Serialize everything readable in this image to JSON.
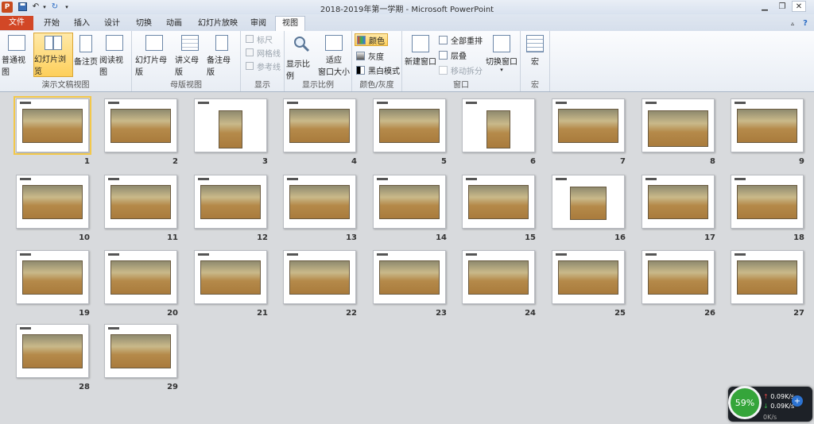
{
  "window": {
    "title": "2018-2019年第一学期 - Microsoft PowerPoint",
    "app_icon": "P"
  },
  "tabs": [
    "文件",
    "开始",
    "插入",
    "设计",
    "切换",
    "动画",
    "幻灯片放映",
    "审阅",
    "视图"
  ],
  "ribbon": {
    "presentation_views": {
      "label": "演示文稿视图",
      "buttons": [
        "普通视图",
        "幻灯片浏览",
        "备注页",
        "阅读视图"
      ]
    },
    "master_views": {
      "label": "母版视图",
      "buttons": [
        "幻灯片母版",
        "讲义母版",
        "备注母版"
      ]
    },
    "show": {
      "label": "显示",
      "checks": [
        "标尺",
        "网格线",
        "参考线"
      ]
    },
    "zoom": {
      "label": "显示比例",
      "buttons": [
        "显示比例",
        "适应",
        "窗口大小"
      ]
    },
    "color": {
      "label": "颜色/灰度",
      "buttons": [
        "颜色",
        "灰度",
        "黑白模式"
      ]
    },
    "window": {
      "label": "窗口",
      "new_window": "新建窗口",
      "arrange_all": "全部重排",
      "cascade": "层叠",
      "move_split": "移动拆分",
      "switch": "切换窗口"
    },
    "macros": {
      "label": "宏",
      "button": "宏"
    }
  },
  "slides": [
    {
      "n": "1",
      "kind": "land"
    },
    {
      "n": "2",
      "kind": "land"
    },
    {
      "n": "3",
      "kind": "port"
    },
    {
      "n": "4",
      "kind": "land"
    },
    {
      "n": "5",
      "kind": "land"
    },
    {
      "n": "6",
      "kind": "port"
    },
    {
      "n": "7",
      "kind": "land"
    },
    {
      "n": "8",
      "kind": "full"
    },
    {
      "n": "9",
      "kind": "land"
    },
    {
      "n": "10",
      "kind": "land"
    },
    {
      "n": "11",
      "kind": "land"
    },
    {
      "n": "12",
      "kind": "land"
    },
    {
      "n": "13",
      "kind": "land"
    },
    {
      "n": "14",
      "kind": "land"
    },
    {
      "n": "15",
      "kind": "land"
    },
    {
      "n": "16",
      "kind": "small"
    },
    {
      "n": "17",
      "kind": "land"
    },
    {
      "n": "18",
      "kind": "land"
    },
    {
      "n": "19",
      "kind": "land"
    },
    {
      "n": "20",
      "kind": "land"
    },
    {
      "n": "21",
      "kind": "land"
    },
    {
      "n": "22",
      "kind": "land"
    },
    {
      "n": "23",
      "kind": "land"
    },
    {
      "n": "24",
      "kind": "land"
    },
    {
      "n": "25",
      "kind": "land"
    },
    {
      "n": "26",
      "kind": "land"
    },
    {
      "n": "27",
      "kind": "land"
    },
    {
      "n": "28",
      "kind": "land"
    },
    {
      "n": "29",
      "kind": "land"
    }
  ],
  "net_widget": {
    "percent": "59%",
    "up": "0.09K/s",
    "down": "0.09K/s",
    "footer": "0K/s"
  },
  "colors": {
    "file_tab": "#d24726",
    "selection": "#f3c84a",
    "floor_photo": "#b58a4a"
  }
}
